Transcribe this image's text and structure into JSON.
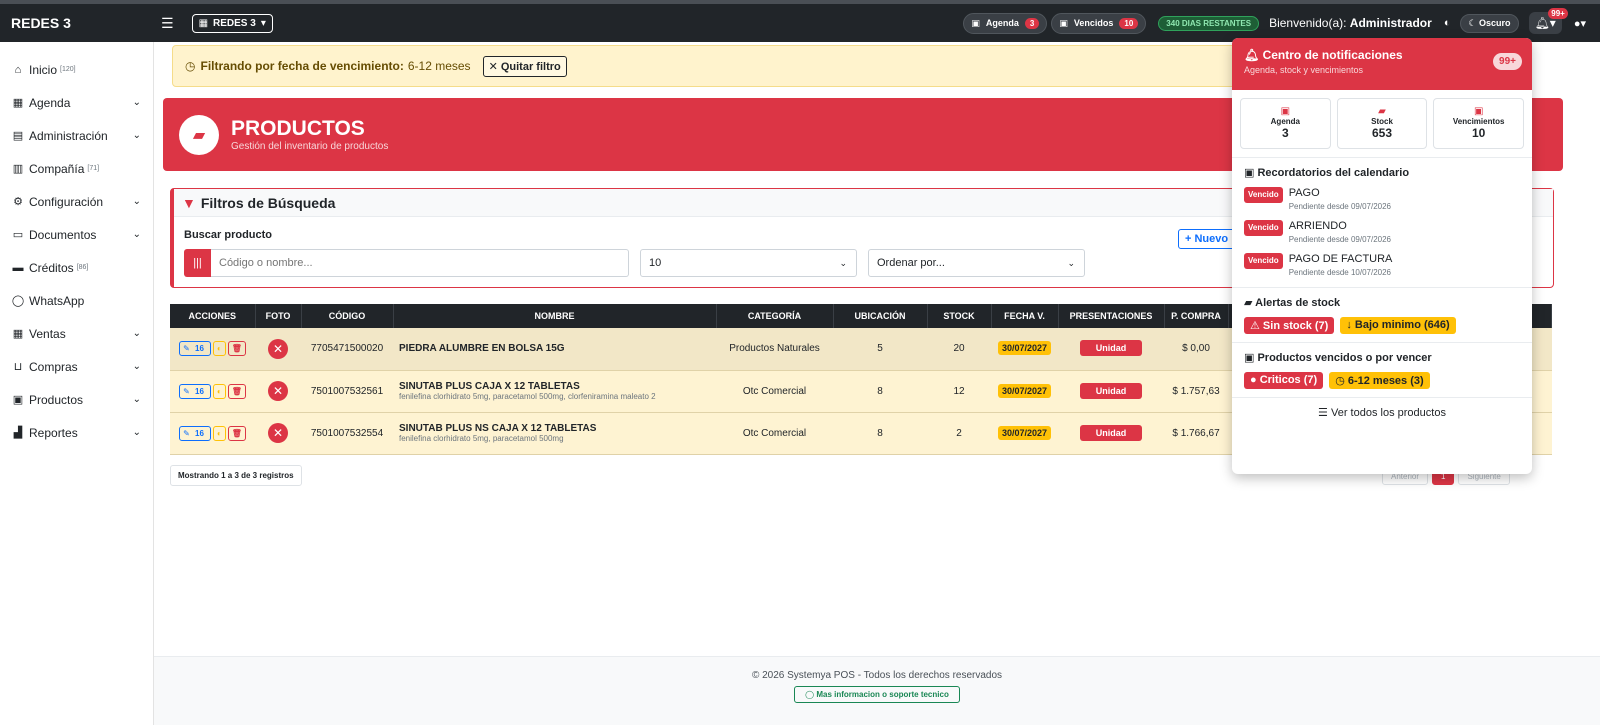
{
  "topbar": {
    "brand": "REDES 3",
    "company": "REDES 3",
    "agenda_label": "Agenda",
    "agenda_count": "3",
    "vencidos_label": "Vencidos",
    "vencidos_count": "10",
    "days_left": "340 DIAS RESTANTES",
    "welcome_prefix": "Bienvenido(a):",
    "welcome_user": "Administrador",
    "dark_label": "Oscuro",
    "bell_badge": "99+"
  },
  "sidebar": {
    "items": [
      {
        "label": "Inicio",
        "count": "[120]",
        "icon": "home-icon"
      },
      {
        "label": "Agenda",
        "icon": "calendar-icon"
      },
      {
        "label": "Administración",
        "icon": "id-card-icon"
      },
      {
        "label": "Compañía",
        "count": "[71]",
        "icon": "building-icon"
      },
      {
        "label": "Configuración",
        "icon": "gears-icon"
      },
      {
        "label": "Documentos",
        "icon": "folder-icon"
      },
      {
        "label": "Créditos",
        "count": "[86]",
        "icon": "card-icon"
      },
      {
        "label": "WhatsApp",
        "icon": "whatsapp-icon"
      },
      {
        "label": "Ventas",
        "icon": "cash-register-icon"
      },
      {
        "label": "Compras",
        "icon": "cart-icon"
      },
      {
        "label": "Productos",
        "icon": "boxes-icon"
      },
      {
        "label": "Reportes",
        "icon": "chart-icon"
      }
    ]
  },
  "filterbar": {
    "label": "Filtrando por fecha de vencimiento:",
    "value": "6-12 meses",
    "remove": "Quitar filtro"
  },
  "hero": {
    "title": "PRODUCTOS",
    "subtitle": "Gestión del inventario de productos"
  },
  "filters": {
    "title": "Filtros de Búsqueda",
    "search_label": "Buscar producto",
    "search_placeholder": "Código o nombre...",
    "page_size": "10",
    "order_placeholder": "Ordenar por...",
    "new_label": "Nuevo"
  },
  "table": {
    "headers": [
      "ACCIONES",
      "FOTO",
      "CÓDIGO",
      "NOMBRE",
      "CATEGORÍA",
      "UBICACIÓN",
      "STOCK",
      "FECHA V.",
      "PRESENTACIONES",
      "P. COMPRA"
    ],
    "rows": [
      {
        "badge": "16",
        "code": "7705471500020",
        "name": "PIEDRA ALUMBRE EN BOLSA 15G",
        "sub": "",
        "category": "Productos Naturales",
        "location": "5",
        "stock": "20",
        "date": "30/07/2027",
        "presentation": "Unidad",
        "price": "$ 0,00"
      },
      {
        "badge": "16",
        "code": "7501007532561",
        "name": "SINUTAB PLUS CAJA X 12 TABLETAS",
        "sub": "fenilefina clorhidrato 5mg, paracetamol 500mg, clorfeniramina maleato 2",
        "category": "Otc Comercial",
        "location": "8",
        "stock": "12",
        "date": "30/07/2027",
        "presentation": "Unidad",
        "price": "$ 1.757,63"
      },
      {
        "badge": "16",
        "code": "7501007532554",
        "name": "SINUTAB PLUS NS CAJA X 12 TABLETAS",
        "sub": "fenilefina clorhidrato 5mg, paracetamol 500mg",
        "category": "Otc Comercial",
        "location": "8",
        "stock": "2",
        "date": "30/07/2027",
        "presentation": "Unidad",
        "price": "$ 1.766,67"
      }
    ],
    "showing": "Mostrando 1 a 3 de 3 registros",
    "prev": "Anterior",
    "page": "1",
    "next": "Siguiente"
  },
  "footer": {
    "copyright": "© 2026 Systemya POS - Todos los derechos reservados",
    "support": "Mas informacion o soporte tecnico"
  },
  "notifications": {
    "title": "Centro de notificaciones",
    "subtitle": "Agenda, stock y vencimientos",
    "badge": "99+",
    "stats": [
      {
        "label": "Agenda",
        "value": "3"
      },
      {
        "label": "Stock",
        "value": "653"
      },
      {
        "label": "Vencimientos",
        "value": "10"
      }
    ],
    "reminders_title": "Recordatorios del calendario",
    "reminders": [
      {
        "badge": "Vencido",
        "title": "PAGO",
        "sub": "Pendiente desde 09/07/2026"
      },
      {
        "badge": "Vencido",
        "title": "ARRIENDO",
        "sub": "Pendiente desde 09/07/2026"
      },
      {
        "badge": "Vencido",
        "title": "PAGO DE FACTURA",
        "sub": "Pendiente desde 10/07/2026"
      }
    ],
    "stock_title": "Alertas de stock",
    "stock_out": "Sin stock",
    "stock_out_count": "(7)",
    "stock_low": "Bajo minimo",
    "stock_low_count": "(646)",
    "exp_title": "Productos vencidos o por vencer",
    "critical": "Criticos",
    "critical_count": "(7)",
    "six_twelve": "6-12 meses",
    "six_twelve_count": "(3)",
    "view_all": "Ver todos los productos"
  }
}
